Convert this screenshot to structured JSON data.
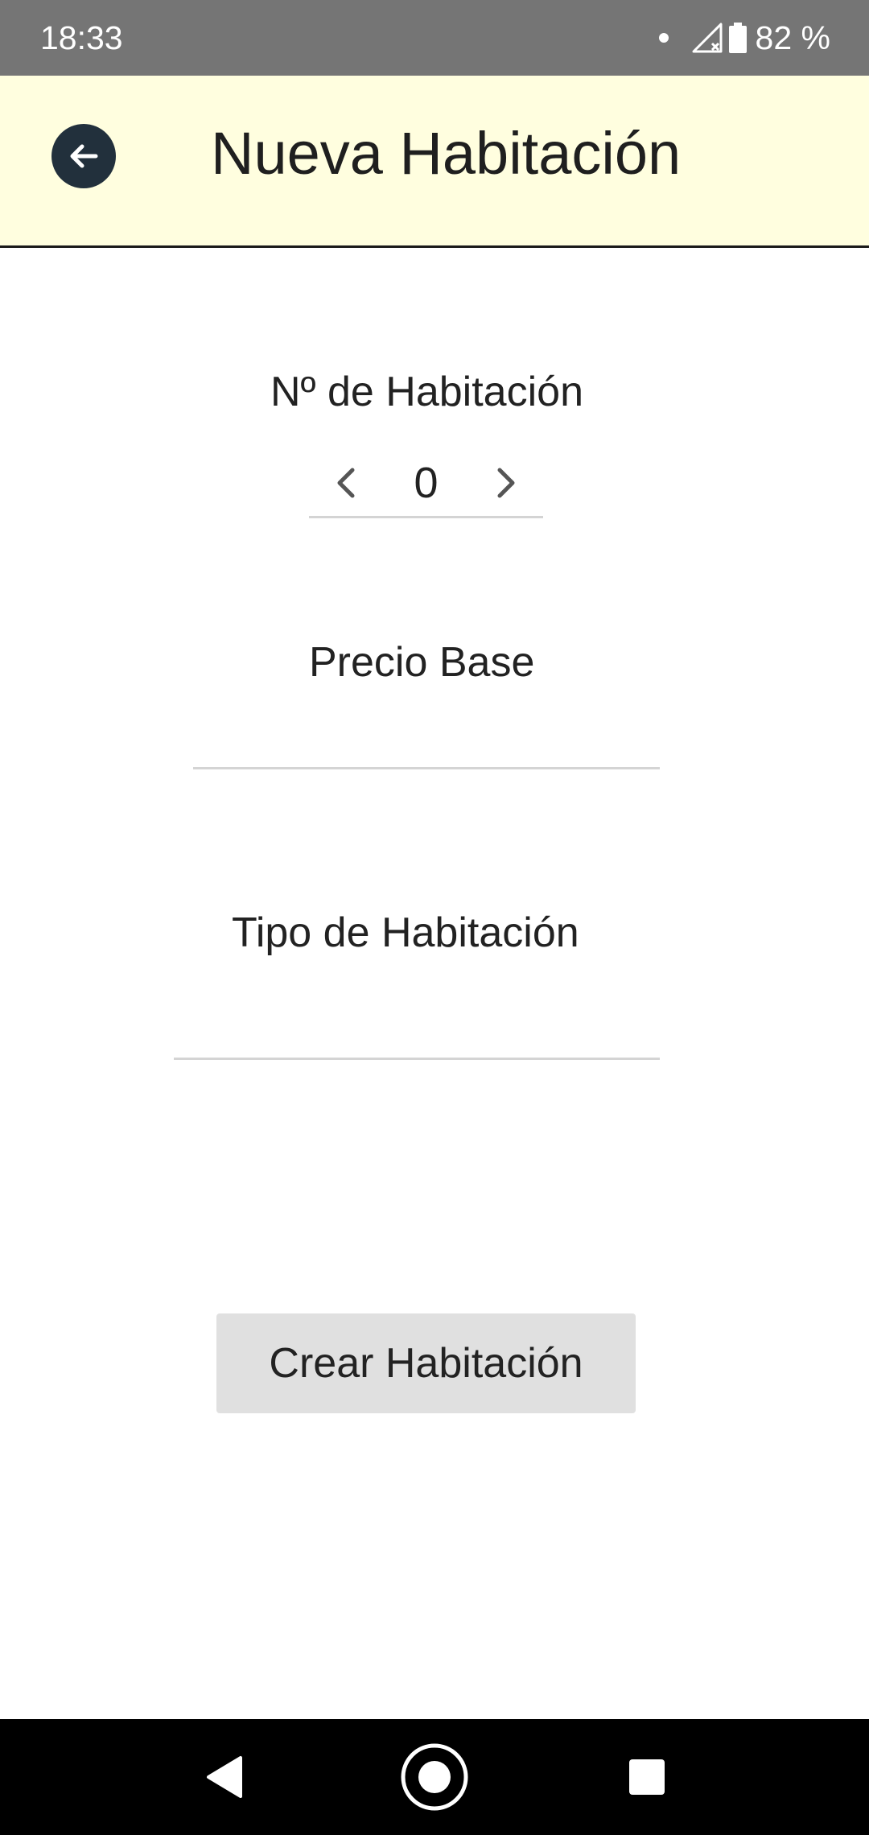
{
  "status_bar": {
    "time": "18:33",
    "battery": "82 %",
    "icons": [
      "notification-dot-icon",
      "signal-no-data-icon",
      "battery-icon"
    ]
  },
  "app_bar": {
    "title": "Nueva Habitación",
    "back_icon": "arrow-left-icon",
    "background": "#fffedf",
    "back_button_color": "#22303c"
  },
  "form": {
    "room_number": {
      "label": "Nº de Habitación",
      "value": "0",
      "prev_icon": "chevron-left-icon",
      "next_icon": "chevron-right-icon"
    },
    "base_price": {
      "label": "Precio Base",
      "value": "",
      "placeholder": ""
    },
    "room_type": {
      "label": "Tipo de Habitación",
      "value": "",
      "placeholder": ""
    },
    "submit_label": "Crear Habitación"
  },
  "nav_bar": {
    "icons": [
      "nav-back-icon",
      "nav-home-icon",
      "nav-recents-icon"
    ]
  }
}
